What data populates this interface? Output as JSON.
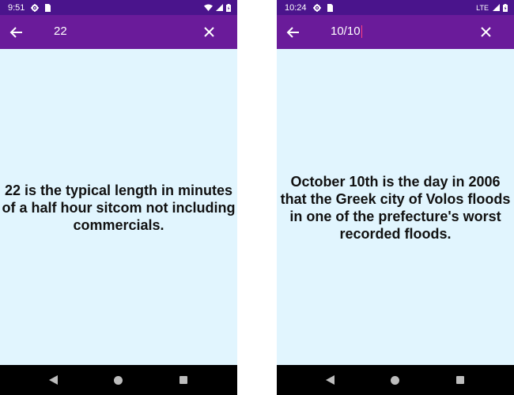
{
  "screens": [
    {
      "status": {
        "time": "9:51",
        "network_label": ""
      },
      "search": {
        "query": "22"
      },
      "fact": "22 is the typical length in minutes of a half hour sitcom not including commercials."
    },
    {
      "status": {
        "time": "10:24",
        "network_label": "LTE"
      },
      "search": {
        "query": "10/10"
      },
      "fact": "October 10th is the day in 2006 that the Greek city of Volos floods in one of the prefecture's worst recorded floods."
    }
  ],
  "colors": {
    "status_bar": "#4a148c",
    "app_bar": "#6a1b9a",
    "content_background": "#e1f5fe",
    "navigation_bar": "#000000",
    "cursor": "#ff4081"
  },
  "icons": {
    "back": "arrow-back-icon",
    "close": "close-icon",
    "settings": "gear-icon",
    "sim": "sim-card-icon",
    "wifi": "wifi-icon",
    "signal": "cell-signal-icon",
    "battery": "battery-icon",
    "nav_back": "nav-back-triangle-icon",
    "nav_home": "nav-home-circle-icon",
    "nav_recents": "nav-recents-square-icon"
  }
}
